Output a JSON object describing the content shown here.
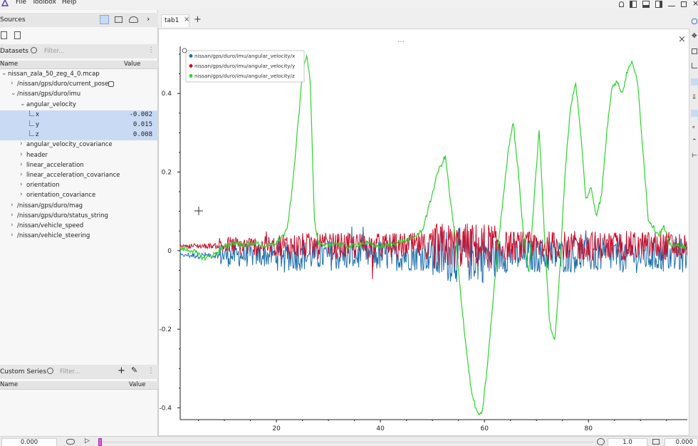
{
  "menubar": {
    "items": [
      "File",
      "Toolbox",
      "Help"
    ]
  },
  "sources": {
    "title": "Sources"
  },
  "datasets": {
    "title": "Datasets",
    "filter_placeholder": "Filter...",
    "col_name": "Name",
    "col_value": "Value",
    "tree": [
      {
        "label": "nissan_zala_50_zeg_4_0.mcap",
        "indent": 0,
        "chev": "down",
        "value": ""
      },
      {
        "label": "/nissan/gps/duro/current_pose",
        "indent": 1,
        "chev": "right",
        "value": "",
        "badge": true
      },
      {
        "label": "/nissan/gps/duro/imu",
        "indent": 1,
        "chev": "down",
        "value": ""
      },
      {
        "label": "angular_velocity",
        "indent": 2,
        "chev": "down",
        "value": ""
      },
      {
        "label": "x",
        "indent": 3,
        "chev": "",
        "value": "-0.002",
        "selected": true
      },
      {
        "label": "y",
        "indent": 3,
        "chev": "",
        "value": "0.015",
        "selected": true
      },
      {
        "label": "z",
        "indent": 3,
        "chev": "",
        "value": "0.008",
        "selected": true
      },
      {
        "label": "angular_velocity_covariance",
        "indent": 2,
        "chev": "right",
        "value": ""
      },
      {
        "label": "header",
        "indent": 2,
        "chev": "right",
        "value": ""
      },
      {
        "label": "linear_acceleration",
        "indent": 2,
        "chev": "right",
        "value": ""
      },
      {
        "label": "linear_acceleration_covariance",
        "indent": 2,
        "chev": "right",
        "value": ""
      },
      {
        "label": "orientation",
        "indent": 2,
        "chev": "right",
        "value": ""
      },
      {
        "label": "orientation_covariance",
        "indent": 2,
        "chev": "right",
        "value": ""
      },
      {
        "label": "/nissan/gps/duro/mag",
        "indent": 1,
        "chev": "right",
        "value": ""
      },
      {
        "label": "/nissan/gps/duro/status_string",
        "indent": 1,
        "chev": "right",
        "value": ""
      },
      {
        "label": "/nissan/vehicle_speed",
        "indent": 1,
        "chev": "right",
        "value": ""
      },
      {
        "label": "/nissan/vehicle_steering",
        "indent": 1,
        "chev": "right",
        "value": ""
      }
    ]
  },
  "custom_series": {
    "title": "Custom Series",
    "filter_placeholder": "Filter...",
    "col_name": "Name",
    "col_value": "Value"
  },
  "tabs": [
    {
      "label": "tab1"
    }
  ],
  "plot": {
    "dots_label": "...",
    "legend": [
      {
        "name": "nissan/gps/duro/imu/angular_velocity/x",
        "color": "#1f6fad"
      },
      {
        "name": "nissan/gps/duro/imu/angular_velocity/y",
        "color": "#c8102e"
      },
      {
        "name": "nissan/gps/duro/imu/angular_velocity/z",
        "color": "#2ed22e"
      }
    ],
    "x_ticks": [
      "20",
      "40",
      "60",
      "80"
    ],
    "y_ticks": [
      "0.4",
      "0.2",
      "0",
      "-0.2",
      "-0.4"
    ]
  },
  "chart_data": {
    "type": "line",
    "x_range": [
      1.5,
      99
    ],
    "ylim": [
      -0.43,
      0.52
    ],
    "xticks": [
      20,
      40,
      60,
      80
    ],
    "yticks": [
      0.4,
      0.2,
      0,
      -0.2,
      -0.4
    ],
    "grid": false,
    "legend_placement": "top-left",
    "series": [
      {
        "name": "nissan/gps/duro/imu/angular_velocity/x",
        "color": "#1f6fad"
      },
      {
        "name": "nissan/gps/duro/imu/angular_velocity/y",
        "color": "#c8102e"
      },
      {
        "name": "nissan/gps/duro/imu/angular_velocity/z",
        "color": "#2ed22e",
        "x": [
          1.5,
          4,
          6,
          8,
          10,
          12,
          14,
          16,
          18,
          20,
          22,
          23,
          24,
          25,
          25.8,
          26.5,
          27.3,
          28,
          29,
          31,
          34,
          37,
          40,
          43,
          46,
          48,
          49.5,
          51,
          52.5,
          53.5,
          54.5,
          55.5,
          56.5,
          57.5,
          58.5,
          59.5,
          60.5,
          61.5,
          62.5,
          63.5,
          64.5,
          65.5,
          66.5,
          67.5,
          68.5,
          69.5,
          70.5,
          71.5,
          72.5,
          73.5,
          74.5,
          75.5,
          76.5,
          77.5,
          78.5,
          79.5,
          80.5,
          81.5,
          82.5,
          83.5,
          84.5,
          85.5,
          86.5,
          87.5,
          88.5,
          89.5,
          90.5,
          91.5,
          92.5,
          93.5,
          94.5,
          95.5,
          96.5,
          97.5,
          99
        ],
        "y": [
          0.005,
          0.0,
          -0.02,
          -0.01,
          0.01,
          0.02,
          0.015,
          0.02,
          0.01,
          0.02,
          0.05,
          0.15,
          0.3,
          0.45,
          0.5,
          0.44,
          0.08,
          0.02,
          0.01,
          0.02,
          0.01,
          0.02,
          0.01,
          0.02,
          0.03,
          0.05,
          0.12,
          0.2,
          0.24,
          0.12,
          0.02,
          -0.12,
          -0.25,
          -0.36,
          -0.41,
          -0.42,
          -0.3,
          -0.15,
          0.0,
          0.12,
          0.25,
          0.33,
          0.2,
          0.04,
          -0.06,
          0.12,
          0.31,
          0.05,
          -0.18,
          -0.23,
          -0.05,
          0.2,
          0.36,
          0.43,
          0.3,
          0.13,
          0.16,
          0.09,
          0.14,
          0.3,
          0.42,
          0.43,
          0.4,
          0.46,
          0.48,
          0.42,
          0.25,
          0.08,
          0.06,
          0.04,
          0.06,
          0.02,
          0.01,
          0.015,
          0.005
        ]
      }
    ]
  },
  "bottom": {
    "time_left": "0.000",
    "speed": "1.0",
    "time_right": "0.000"
  }
}
